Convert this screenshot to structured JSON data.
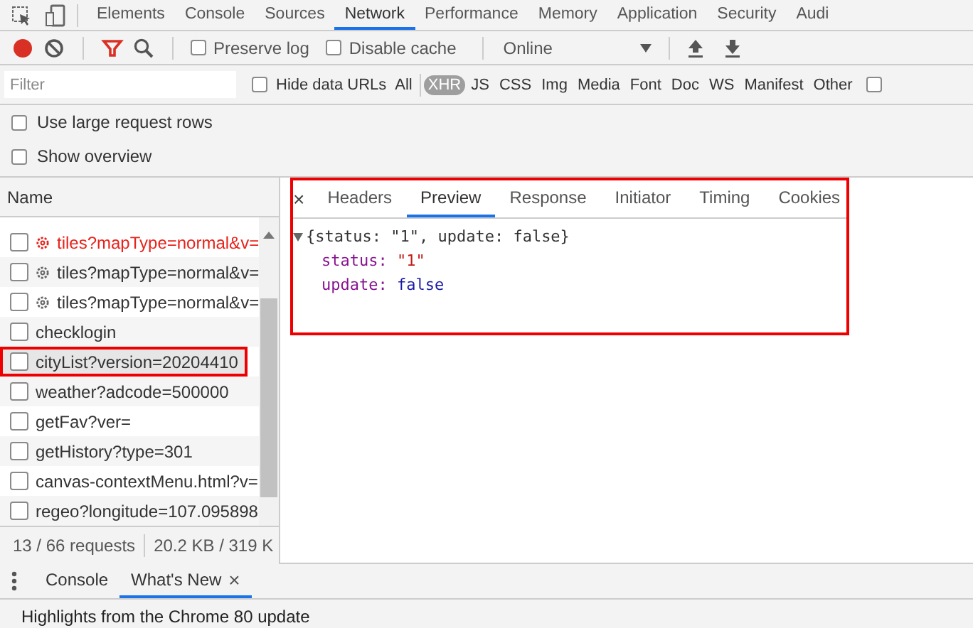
{
  "main_tabs": [
    {
      "label": "Elements",
      "selected": false
    },
    {
      "label": "Console",
      "selected": false
    },
    {
      "label": "Sources",
      "selected": false
    },
    {
      "label": "Network",
      "selected": true
    },
    {
      "label": "Performance",
      "selected": false
    },
    {
      "label": "Memory",
      "selected": false
    },
    {
      "label": "Application",
      "selected": false
    },
    {
      "label": "Security",
      "selected": false
    },
    {
      "label": "Audi",
      "selected": false
    }
  ],
  "toolbar": {
    "recording": true,
    "filter_active": true,
    "checkboxes": [
      {
        "label": "Preserve log",
        "checked": false
      },
      {
        "label": "Disable cache",
        "checked": false
      }
    ],
    "throttling": "Online"
  },
  "filter_bar": {
    "placeholder": "Filter",
    "hide_data_urls": {
      "label": "Hide data URLs",
      "checked": false
    },
    "types": [
      {
        "label": "All",
        "selected": false
      },
      {
        "label": "XHR",
        "selected": true
      },
      {
        "label": "JS",
        "selected": false
      },
      {
        "label": "CSS",
        "selected": false
      },
      {
        "label": "Img",
        "selected": false
      },
      {
        "label": "Media",
        "selected": false
      },
      {
        "label": "Font",
        "selected": false
      },
      {
        "label": "Doc",
        "selected": false
      },
      {
        "label": "WS",
        "selected": false
      },
      {
        "label": "Manifest",
        "selected": false
      },
      {
        "label": "Other",
        "selected": false
      }
    ],
    "extra_checkbox": {
      "checked": false
    }
  },
  "options": [
    {
      "label": "Use large request rows",
      "checked": false
    },
    {
      "label": "Show overview",
      "checked": false
    }
  ],
  "requests": {
    "column": "Name",
    "rows": [
      {
        "name": "tiles?mapType=normal&v=",
        "kind": "tile",
        "error": true,
        "selected": false,
        "highlighted": false
      },
      {
        "name": "tiles?mapType=normal&v=",
        "kind": "tile",
        "error": false,
        "selected": false,
        "highlighted": false
      },
      {
        "name": "tiles?mapType=normal&v=",
        "kind": "tile",
        "error": false,
        "selected": false,
        "highlighted": false
      },
      {
        "name": "checklogin",
        "kind": "plain",
        "error": false,
        "selected": false,
        "highlighted": false
      },
      {
        "name": "cityList?version=20204410",
        "kind": "plain",
        "error": false,
        "selected": true,
        "highlighted": true
      },
      {
        "name": "weather?adcode=500000",
        "kind": "plain",
        "error": false,
        "selected": false,
        "highlighted": false
      },
      {
        "name": "getFav?ver=",
        "kind": "plain",
        "error": false,
        "selected": false,
        "highlighted": false
      },
      {
        "name": "getHistory?type=301",
        "kind": "plain",
        "error": false,
        "selected": false,
        "highlighted": false
      },
      {
        "name": "canvas-contextMenu.html?v=",
        "kind": "plain",
        "error": false,
        "selected": false,
        "highlighted": false
      },
      {
        "name": "regeo?longitude=107.095898",
        "kind": "plain",
        "error": false,
        "selected": false,
        "highlighted": false
      }
    ],
    "summary": [
      "13 / 66 requests",
      "20.2 KB / 319 K"
    ]
  },
  "details": {
    "highlighted": true,
    "close": "×",
    "tabs": [
      {
        "label": "Headers",
        "selected": false
      },
      {
        "label": "Preview",
        "selected": true
      },
      {
        "label": "Response",
        "selected": false
      },
      {
        "label": "Initiator",
        "selected": false
      },
      {
        "label": "Timing",
        "selected": false
      },
      {
        "label": "Cookies",
        "selected": false
      }
    ],
    "preview": {
      "summary": "{status: \"1\", update: false}",
      "expanded": true,
      "properties": [
        {
          "key": "status:",
          "value": "\"1\"",
          "kind": "string"
        },
        {
          "key": "update:",
          "value": "false",
          "kind": "boolean"
        }
      ]
    }
  },
  "drawer": {
    "tabs": [
      {
        "label": "Console",
        "selected": false
      },
      {
        "label": "What's New",
        "selected": true,
        "close": "×"
      }
    ],
    "text": "Highlights from the Chrome 80 update"
  }
}
